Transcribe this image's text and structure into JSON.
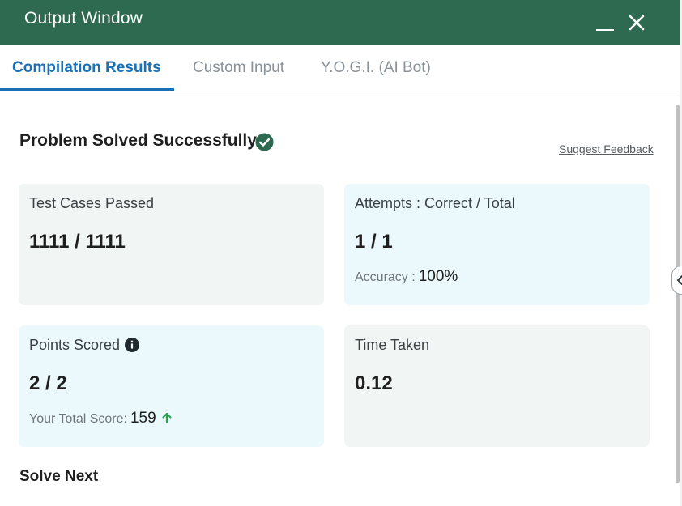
{
  "window": {
    "title": "Output Window",
    "minimize_icon": "minimize-icon",
    "close_icon": "close-icon",
    "header_color": "#2d6a4f"
  },
  "tabs": [
    {
      "label": "Compilation Results",
      "active": true
    },
    {
      "label": "Custom Input",
      "active": false
    },
    {
      "label": "Y.O.G.I. (AI Bot)",
      "active": false
    }
  ],
  "result": {
    "headline": "Problem Solved Successfully",
    "status_icon": "check-circle-icon",
    "status_color": "#2d6a4f",
    "feedback_link": "Suggest Feedback"
  },
  "cards": {
    "test_cases": {
      "label": "Test Cases Passed",
      "value": "1111 / 1111"
    },
    "attempts": {
      "label": "Attempts : Correct / Total",
      "value": "1 / 1",
      "sub_label": "Accuracy :",
      "sub_value": "100%"
    },
    "points": {
      "label": "Points Scored",
      "info_icon": "info-icon",
      "value": "2 / 2",
      "sub_label": "Your Total Score:",
      "sub_value": "159",
      "trend_icon": "arrow-up-icon"
    },
    "time": {
      "label": "Time Taken",
      "value": "0.12"
    }
  },
  "footer": {
    "solve_next": "Solve Next"
  },
  "colors": {
    "accent": "#1a6fb5",
    "card_gray": "#f1f5f3",
    "card_blue": "#ebf9fc",
    "trend_up": "#2ea44f"
  }
}
